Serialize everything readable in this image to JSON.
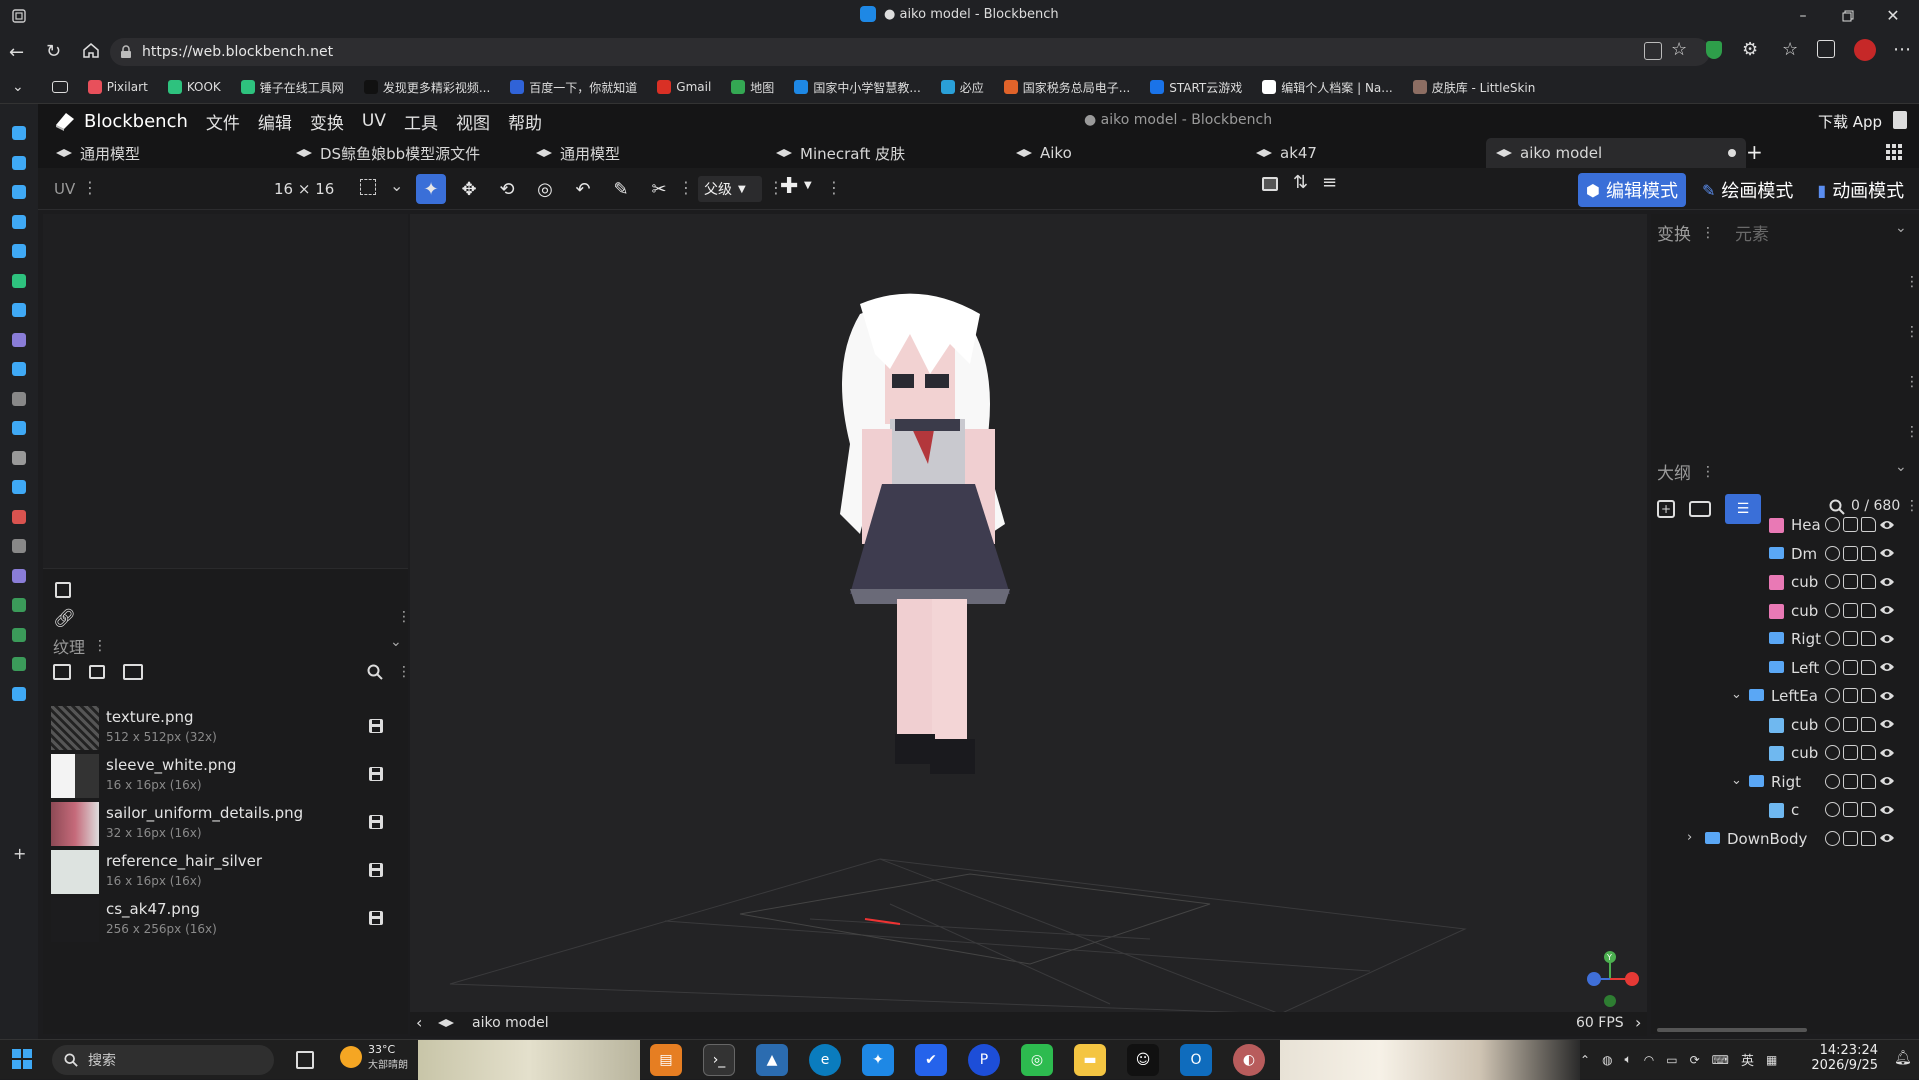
{
  "browser": {
    "window_title": "● aiko model - Blockbench",
    "url": "https://web.blockbench.net",
    "bookmarks": [
      {
        "label": "Pixilart",
        "color": "#e8505b"
      },
      {
        "label": "KOOK",
        "color": "#2ec27e"
      },
      {
        "label": "锤子在线工具网",
        "color": "#2ec27e"
      },
      {
        "label": "发现更多精彩视频...",
        "color": "#111111"
      },
      {
        "label": "百度一下，你就知道",
        "color": "#3063d8"
      },
      {
        "label": "Gmail",
        "color": "#d93025"
      },
      {
        "label": "地图",
        "color": "#34a853"
      },
      {
        "label": "国家中小学智慧教...",
        "color": "#1e88e5"
      },
      {
        "label": "必应",
        "color": "#2aa0d8"
      },
      {
        "label": "国家税务总局电子...",
        "color": "#e0632a"
      },
      {
        "label": "START云游戏",
        "color": "#1a73e8"
      },
      {
        "label": "编辑个人档案 | Na...",
        "color": "#ffffff"
      },
      {
        "label": "皮肤库 - LittleSkin",
        "color": "#8d6e63"
      }
    ]
  },
  "app": {
    "logo": "Blockbench",
    "menu": [
      "文件",
      "编辑",
      "变换",
      "UV",
      "工具",
      "视图",
      "帮助"
    ],
    "center_title": "● aiko model - Blockbench",
    "download_label": "下载 App",
    "tabs": [
      {
        "label": "通用模型",
        "active": false
      },
      {
        "label": "DS鲸鱼娘bb模型源文件",
        "active": false
      },
      {
        "label": "通用模型",
        "active": false
      },
      {
        "label": "Minecraft 皮肤",
        "active": false
      },
      {
        "label": "Aiko",
        "active": false
      },
      {
        "label": "ak47",
        "active": false
      },
      {
        "label": "aiko model",
        "active": true
      }
    ],
    "toolbar": {
      "uv_label": "UV",
      "uv_size": "16 × 16",
      "pivot_select": "父级",
      "modes": [
        {
          "label": "编辑模式",
          "active": true
        },
        {
          "label": "绘画模式",
          "active": false
        },
        {
          "label": "动画模式",
          "active": false
        }
      ]
    },
    "textures": {
      "title": "纹理",
      "items": [
        {
          "name": "texture.png",
          "size": "512 x 512px (32x)"
        },
        {
          "name": "sleeve_white.png",
          "size": "16 x 16px (16x)"
        },
        {
          "name": "sailor_uniform_details.png",
          "size": "32 x 16px (16x)"
        },
        {
          "name": "reference_hair_silver",
          "size": "16 x 16px (16x)"
        },
        {
          "name": "cs_ak47.png",
          "size": "256 x 256px (16x)"
        }
      ]
    },
    "right": {
      "transform_tab": "变换",
      "element_tab": "元素",
      "outliner_title": "大纲",
      "outliner_count": "0 / 680",
      "outliner": [
        {
          "name": "Hea",
          "type": "cube",
          "depth": 2,
          "expanded": null
        },
        {
          "name": "Dm",
          "type": "folder",
          "depth": 2,
          "expanded": null
        },
        {
          "name": "cub",
          "type": "cube",
          "depth": 2,
          "expanded": null
        },
        {
          "name": "cub",
          "type": "cube",
          "depth": 2,
          "expanded": null
        },
        {
          "name": "Rigt",
          "type": "folder",
          "depth": 2,
          "expanded": null
        },
        {
          "name": "Left",
          "type": "folder",
          "depth": 2,
          "expanded": null
        },
        {
          "name": "LeftEa",
          "type": "folder",
          "depth": 1,
          "expanded": true
        },
        {
          "name": "cub",
          "type": "cube-blue",
          "depth": 2,
          "expanded": null
        },
        {
          "name": "cub",
          "type": "cube-blue",
          "depth": 2,
          "expanded": null
        },
        {
          "name": "Rigt",
          "type": "folder",
          "depth": 1,
          "expanded": true
        },
        {
          "name": "c",
          "type": "cube-blue",
          "depth": 2,
          "expanded": null
        },
        {
          "name": "DownBody",
          "type": "folder",
          "depth": 0,
          "expanded": false
        }
      ]
    },
    "status": {
      "model_name": "aiko model",
      "fps": "60 FPS"
    }
  },
  "taskbar": {
    "search_placeholder": "搜索",
    "weather_temp": "33°C",
    "weather_desc": "大部晴朗",
    "ime": "英",
    "time": "14:23:24",
    "date": "2026/9/25"
  }
}
